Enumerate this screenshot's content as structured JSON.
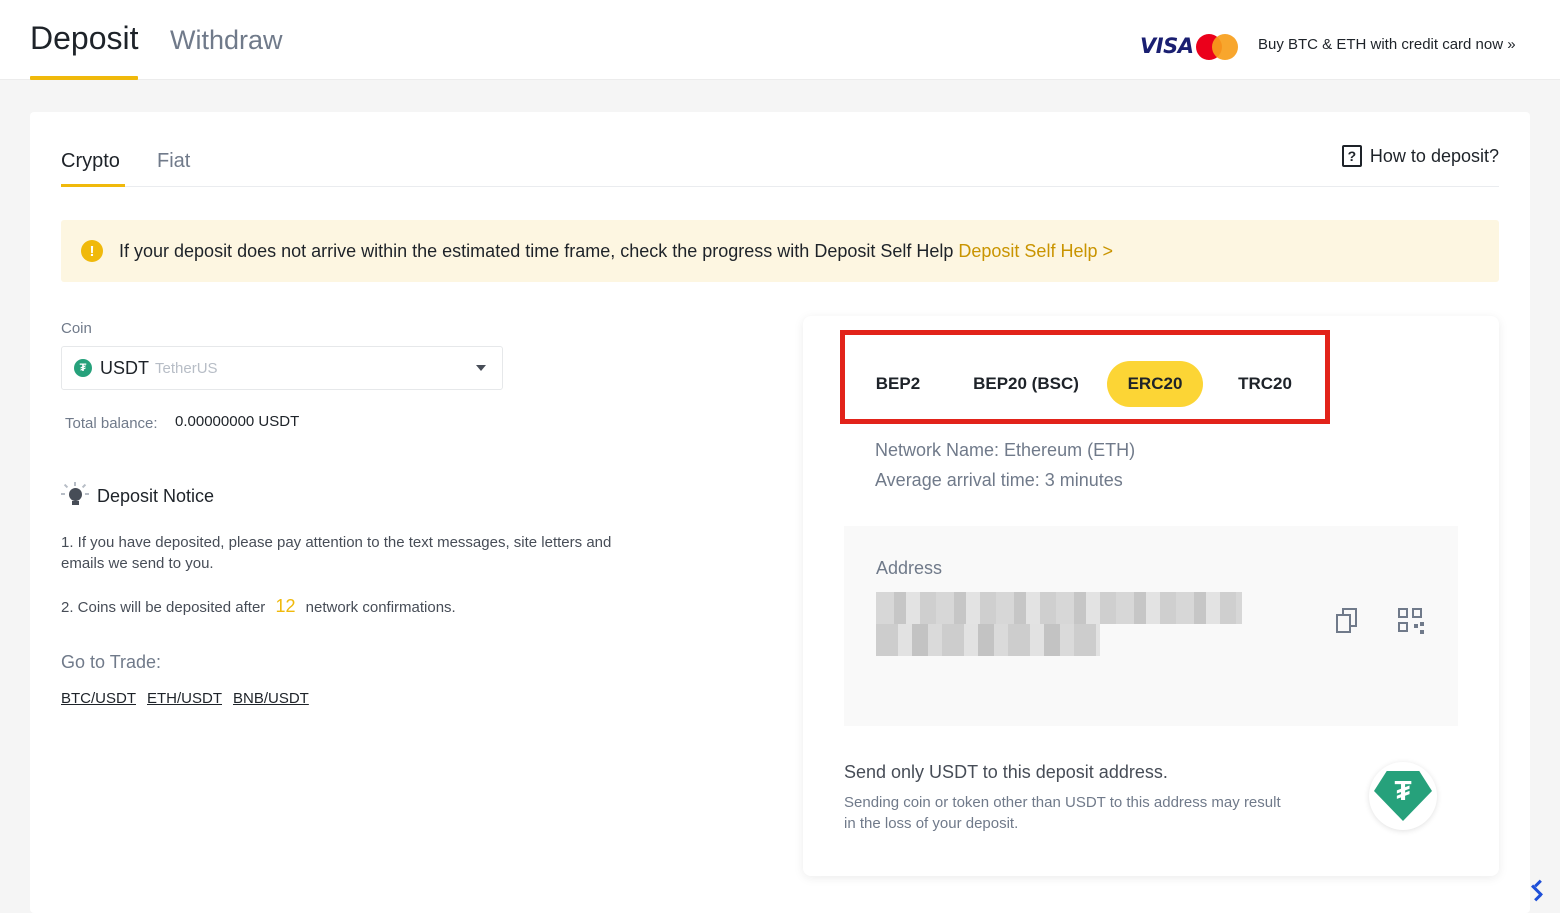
{
  "header": {
    "tab_deposit": "Deposit",
    "tab_withdraw": "Withdraw",
    "visa_text": "VISA",
    "mastercard_text": "MasterCard",
    "buy_link": "Buy BTC & ETH with credit card now »"
  },
  "tabs": {
    "crypto": "Crypto",
    "fiat": "Fiat",
    "how_to": "How to deposit?"
  },
  "alert": {
    "message": "If your deposit does not arrive within the estimated time frame, check the progress with Deposit Self Help",
    "link": "Deposit Self Help >"
  },
  "coin": {
    "label": "Coin",
    "symbol": "USDT",
    "name": "TetherUS",
    "balance_label": "Total balance:",
    "balance_value": "0.00000000 USDT"
  },
  "notice": {
    "title": "Deposit Notice",
    "item1": "1. If you have deposited, please pay attention to the text messages, site letters and emails we send to you.",
    "item2_prefix": "2. Coins will be deposited after",
    "item2_number": "12",
    "item2_suffix": "network confirmations.",
    "goto_label": "Go to Trade:",
    "trade_links": [
      "BTC/USDT",
      "ETH/USDT",
      "BNB/USDT"
    ]
  },
  "network": {
    "options": [
      "BEP2",
      "BEP20 (BSC)",
      "ERC20",
      "TRC20"
    ],
    "selected": "ERC20",
    "network_name": "Network Name: Ethereum (ETH)",
    "arrival_time": "Average arrival time: 3 minutes"
  },
  "address": {
    "label": "Address",
    "send_title": "Send only USDT to this deposit address.",
    "send_desc": "Sending coin or token other than USDT to this address may result in the loss of your deposit."
  },
  "colors": {
    "accent": "#f0b90b",
    "highlight_box": "#e2231a",
    "tether_green": "#26a17b"
  }
}
